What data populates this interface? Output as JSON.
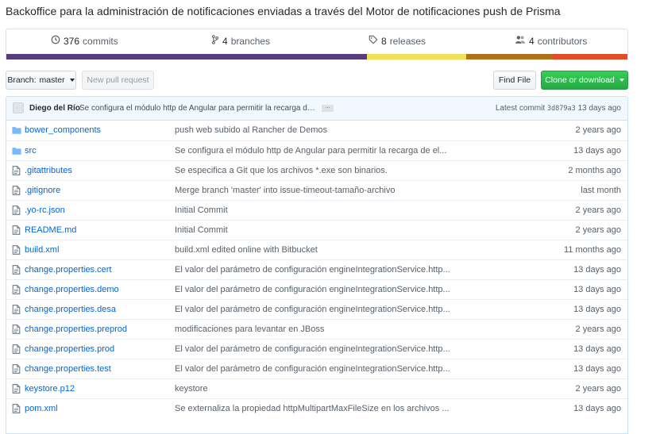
{
  "repo": {
    "description": "Backoffice para la administración de notificaciones enviadas a través del Motor de notificaciones push de Prisma"
  },
  "summary": {
    "commits": {
      "count": "376",
      "label": "commits"
    },
    "branches": {
      "count": "4",
      "label": "branches"
    },
    "releases": {
      "count": "8",
      "label": "releases"
    },
    "contributors": {
      "count": "4",
      "label": "contributors"
    },
    "language_bar": [
      {
        "percent": 58.0,
        "color": "#563d7c"
      },
      {
        "percent": 16.0,
        "color": "#f1e05a"
      },
      {
        "percent": 14.0,
        "color": "#b07219"
      },
      {
        "percent": 12.0,
        "color": "#e34c26"
      }
    ]
  },
  "toolbar": {
    "branch_label": "Branch:",
    "branch_value": "master",
    "new_pull_request": "New pull request",
    "find_file": "Find File",
    "clone_download": "Clone or download"
  },
  "latest_commit": {
    "author": "Diego del Río",
    "message": "Se configura el módulo http de Angular para permitir la recarga de el...",
    "ellipsis": "…",
    "prefix": "Latest commit",
    "sha": "3d879a3",
    "age": "13 days ago"
  },
  "files": [
    {
      "type": "dir",
      "name": "bower_components",
      "message": "push web subido al Rancher de Demos",
      "age": "2 years ago"
    },
    {
      "type": "dir",
      "name": "src",
      "message": "Se configura el módulo http de Angular para permitir la recarga de el...",
      "age": "13 days ago"
    },
    {
      "type": "file",
      "name": ".gitattributes",
      "message": "Se especifica a Git que los archivos *.exe son binarios.",
      "age": "2 months ago"
    },
    {
      "type": "file",
      "name": ".gitignore",
      "message": "Merge branch 'master' into issue-timeout-tamaño-archivo",
      "age": "last month"
    },
    {
      "type": "file",
      "name": ".yo-rc.json",
      "message": "Initial Commit",
      "age": "2 years ago"
    },
    {
      "type": "file",
      "name": "README.md",
      "message": "Initial Commit",
      "age": "2 years ago"
    },
    {
      "type": "file",
      "name": "build.xml",
      "message": "build.xml edited online with Bitbucket",
      "age": "11 months ago"
    },
    {
      "type": "file",
      "name": "change.properties.cert",
      "message": "El valor del parámetro de configuración engineIntegrationService.http...",
      "age": "13 days ago"
    },
    {
      "type": "file",
      "name": "change.properties.demo",
      "message": "El valor del parámetro de configuración engineIntegrationService.http...",
      "age": "13 days ago"
    },
    {
      "type": "file",
      "name": "change.properties.desa",
      "message": "El valor del parámetro de configuración engineIntegrationService.http...",
      "age": "13 days ago"
    },
    {
      "type": "file",
      "name": "change.properties.preprod",
      "message": "modificaciones para levantar en JBoss",
      "age": "2 years ago"
    },
    {
      "type": "file",
      "name": "change.properties.prod",
      "message": "El valor del parámetro de configuración engineIntegrationService.http...",
      "age": "13 days ago"
    },
    {
      "type": "file",
      "name": "change.properties.test",
      "message": "El valor del parámetro de configuración engineIntegrationService.http...",
      "age": "13 days ago"
    },
    {
      "type": "file",
      "name": "keystore.p12",
      "message": "keystore",
      "age": "2 years ago"
    },
    {
      "type": "file",
      "name": "pom.xml",
      "message": "Se externaliza la propiedad httpMultipartMaxFileSize en los archivos ...",
      "age": "13 days ago"
    }
  ],
  "colors": {
    "link": "#0366d6",
    "folder_icon": "#79b8ff",
    "file_icon": "#6a737d",
    "green_button": "#28a745"
  }
}
